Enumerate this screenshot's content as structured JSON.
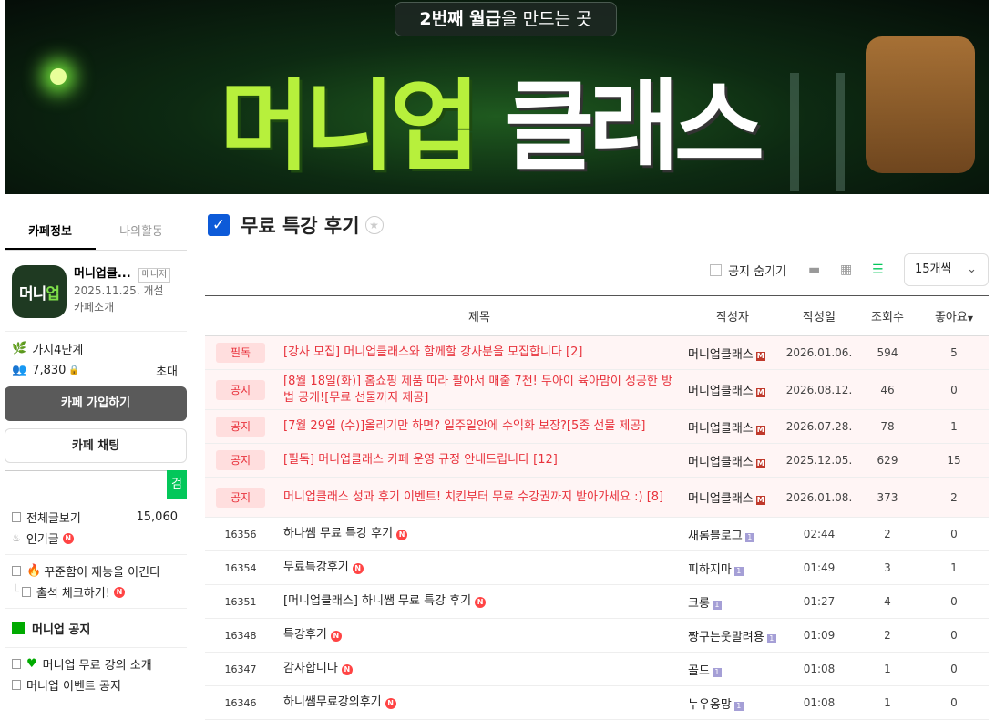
{
  "banner": {
    "slogan_bold": "2번째 월급",
    "slogan_rest": "을 만드는 곳",
    "title_green": "머니업",
    "title_white": "클래스"
  },
  "sidebar": {
    "tabs": [
      "카페정보",
      "나의활동"
    ],
    "cafe_name": "머니업클...",
    "manager_label": "매니저",
    "created": "2025.11.25. 개설",
    "intro_link": "카페소개",
    "logo_text_white": "머니",
    "logo_text_green": "업",
    "level": "가지4단계",
    "members": "7,830",
    "invite": "초대",
    "join_button": "카페 가입하기",
    "chat_button": "카페 채팅",
    "search_button": "검색",
    "all_posts_label": "전체글보기",
    "all_posts_count": "15,060",
    "popular_label": "인기글",
    "menu": [
      {
        "label": "꾸준함이 재능을 이긴다"
      },
      {
        "label": "출석 체크하기!"
      }
    ],
    "notice_section": "머니업 공지",
    "notice_menu": [
      {
        "label": "머니업 무료 강의 소개"
      },
      {
        "label": "머니업 이벤트 공지"
      }
    ]
  },
  "board": {
    "title": "무료 특강 후기",
    "hide_notice": "공지 숨기기",
    "per_page": "15개씩",
    "headers": [
      "제목",
      "작성자",
      "작성일",
      "조회수",
      "좋아요"
    ],
    "notices": [
      {
        "badge": "필독",
        "title": "[강사 모집] 머니업클래스와 함께할 강사분을 모집합니다 [2]",
        "author": "머니업클래스",
        "date": "2026.01.06.",
        "views": "594",
        "likes": "5"
      },
      {
        "badge": "공지",
        "title": "[8월 18일(화)] 홈쇼핑 제품 따라 팔아서 매출 7천! 두아이 육아맘이 성공한 방법 공개![무료 선물까지 제공]",
        "author": "머니업클래스",
        "date": "2026.08.12.",
        "views": "46",
        "likes": "0"
      },
      {
        "badge": "공지",
        "title": "[7월 29일 (수)]올리기만 하면? 일주일안에 수익화 보장?[5종 선물 제공]",
        "author": "머니업클래스",
        "date": "2026.07.28.",
        "views": "78",
        "likes": "1"
      },
      {
        "badge": "공지",
        "title": "[필독] 머니업클래스 카페 운영 규정 안내드립니다 [12]",
        "author": "머니업클래스",
        "date": "2025.12.05.",
        "views": "629",
        "likes": "15"
      },
      {
        "badge": "공지",
        "title": "머니업클래스 성과 후기 이벤트! 치킨부터 무료 수강권까지 받아가세요 :) [8]",
        "author": "머니업클래스",
        "date": "2026.01.08.",
        "views": "373",
        "likes": "2"
      }
    ],
    "posts": [
      {
        "num": "16356",
        "title": "하나쌤 무료 특강 후기",
        "author": "새롬블로그",
        "date": "02:44",
        "views": "2",
        "likes": "0"
      },
      {
        "num": "16354",
        "title": "무료특강후기",
        "author": "피하지마",
        "date": "01:49",
        "views": "3",
        "likes": "1"
      },
      {
        "num": "16351",
        "title": "[머니업클래스] 하니쌤 무료 특강 후기",
        "author": "크롱",
        "date": "01:27",
        "views": "4",
        "likes": "0"
      },
      {
        "num": "16348",
        "title": "특강후기",
        "author": "짱구는웃말려용",
        "date": "01:09",
        "views": "2",
        "likes": "0"
      },
      {
        "num": "16347",
        "title": "감사합니다",
        "author": "골드",
        "date": "01:08",
        "views": "1",
        "likes": "0"
      },
      {
        "num": "16346",
        "title": "하니쌤무료강의후기",
        "author": "누우옹망",
        "date": "01:08",
        "views": "1",
        "likes": "0"
      }
    ]
  }
}
